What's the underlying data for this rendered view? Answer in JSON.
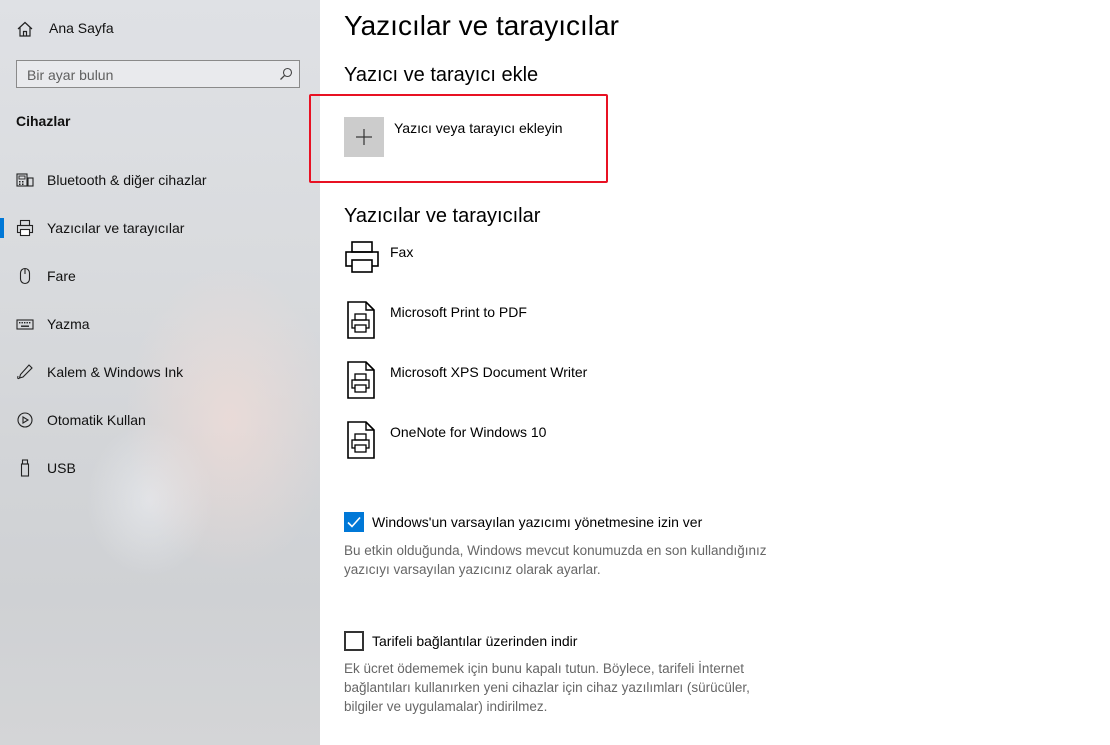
{
  "sidebar": {
    "home_label": "Ana Sayfa",
    "search_placeholder": "Bir ayar bulun",
    "section_title": "Cihazlar",
    "items": [
      {
        "label": "Bluetooth & diğer cihazlar",
        "icon": "bluetooth-devices-icon"
      },
      {
        "label": "Yazıcılar ve tarayıcılar",
        "icon": "printer-icon",
        "active": true
      },
      {
        "label": "Fare",
        "icon": "mouse-icon"
      },
      {
        "label": "Yazma",
        "icon": "keyboard-icon"
      },
      {
        "label": "Kalem & Windows Ink",
        "icon": "pen-icon"
      },
      {
        "label": "Otomatik Kullan",
        "icon": "autoplay-icon"
      },
      {
        "label": "USB",
        "icon": "usb-icon"
      }
    ],
    "accent_color": "#0078d7"
  },
  "main": {
    "title": "Yazıcılar ve tarayıcılar",
    "add_section_title": "Yazıcı ve tarayıcı ekle",
    "add_button_label": "Yazıcı veya tarayıcı ekleyin",
    "printers_section_title": "Yazıcılar ve tarayıcılar",
    "printers": [
      {
        "name": "Fax"
      },
      {
        "name": "Microsoft Print to PDF"
      },
      {
        "name": "Microsoft XPS Document Writer"
      },
      {
        "name": "OneNote for Windows 10"
      }
    ],
    "default_printer_option": {
      "label": "Windows'un varsayılan yazıcımı yönetmesine izin ver",
      "checked": true,
      "description_line1": "Bu etkin olduğunda, Windows mevcut konumuzda en son kullandığınız",
      "description_line2": "yazıcıyı varsayılan yazıcınız olarak ayarlar."
    },
    "metered_option": {
      "label": "Tarifeli bağlantılar üzerinden indir",
      "checked": false,
      "description_line1": "Ek ücret ödememek için bunu kapalı tutun. Böylece, tarifeli İnternet",
      "description_line2": "bağlantıları kullanırken yeni cihazlar için cihaz yazılımları (sürücüler,",
      "description_line3": "bilgiler ve uygulamalar) indirilmez."
    },
    "highlight_color": "#e81123"
  }
}
